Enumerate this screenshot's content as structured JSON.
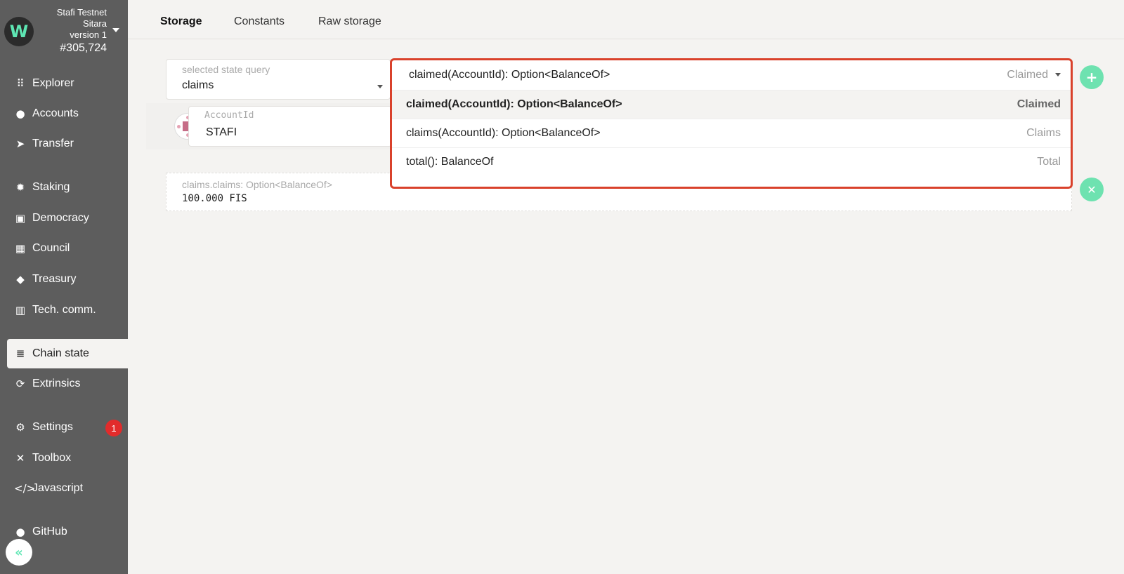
{
  "chain": {
    "name": "Stafi Testnet",
    "network": "Sitara",
    "version": "version 1",
    "block": "#305,724"
  },
  "sidebar": {
    "items": [
      {
        "label": "Explorer",
        "icon": "grid-icon"
      },
      {
        "label": "Accounts",
        "icon": "users-icon"
      },
      {
        "label": "Transfer",
        "icon": "paper-plane-icon"
      },
      {
        "label": "Staking",
        "icon": "certificate-icon"
      },
      {
        "label": "Democracy",
        "icon": "calendar-check-icon"
      },
      {
        "label": "Council",
        "icon": "building-icon"
      },
      {
        "label": "Treasury",
        "icon": "gem-icon"
      },
      {
        "label": "Tech. comm.",
        "icon": "microchip-icon"
      },
      {
        "label": "Chain state",
        "icon": "database-icon"
      },
      {
        "label": "Extrinsics",
        "icon": "sync-icon"
      },
      {
        "label": "Settings",
        "icon": "cogs-icon"
      },
      {
        "label": "Toolbox",
        "icon": "tools-icon"
      },
      {
        "label": "Javascript",
        "icon": "code-icon"
      },
      {
        "label": "GitHub",
        "icon": "github-icon"
      }
    ],
    "settings_badge": "1",
    "active": "Chain state"
  },
  "tabs": [
    {
      "label": "Storage"
    },
    {
      "label": "Constants"
    },
    {
      "label": "Raw storage"
    }
  ],
  "query": {
    "label": "selected state query",
    "value": "claims"
  },
  "param": {
    "label": "AccountId",
    "value": "STAFI"
  },
  "dropdown": {
    "current": {
      "label": "claimed(AccountId): Option<BalanceOf>",
      "alias": "Claimed"
    },
    "options": [
      {
        "label": "claimed(AccountId): Option<BalanceOf>",
        "alias": "Claimed"
      },
      {
        "label": "claims(AccountId): Option<BalanceOf>",
        "alias": "Claims"
      },
      {
        "label": "total(): BalanceOf",
        "alias": "Total"
      }
    ]
  },
  "result": {
    "label": "claims.claims: Option<BalanceOf>",
    "value": "100.000 FIS"
  },
  "colors": {
    "sidebar_bg": "#5d5d5d",
    "accent": "#6ee2b0",
    "highlight_border": "#d9412b",
    "badge": "#e22b2b"
  }
}
